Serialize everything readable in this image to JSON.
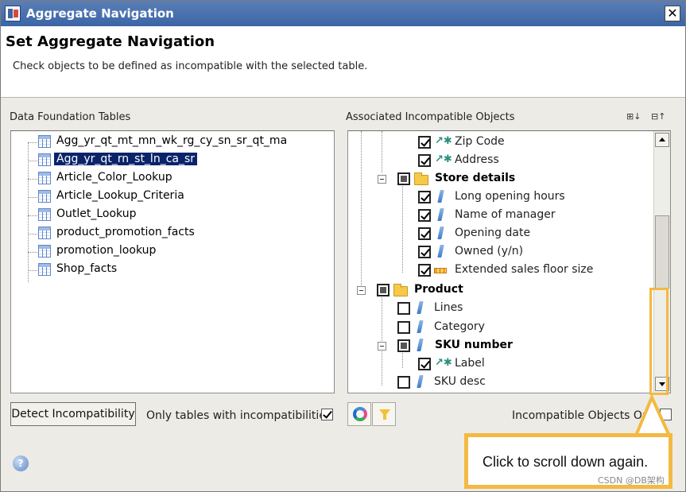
{
  "window": {
    "title": "Aggregate Navigation",
    "close_label": "✕"
  },
  "header": {
    "title": "Set Aggregate Navigation",
    "subtitle": "Check objects to be defined as incompatible with the selected table."
  },
  "left": {
    "label": "Data Foundation Tables",
    "tables": [
      "Agg_yr_qt_mt_mn_wk_rg_cy_sn_sr_qt_ma",
      "Agg_yr_qt_rn_st_ln_ca_sr",
      "Article_Color_Lookup",
      "Article_Lookup_Criteria",
      "Outlet_Lookup",
      "product_promotion_facts",
      "promotion_lookup",
      "Shop_facts"
    ],
    "selected_table": "Agg_yr_qt_rn_st_ln_ca_sr"
  },
  "right": {
    "label": "Associated Incompatible Objects",
    "items": [
      {
        "text": "Zip Code",
        "icon": "attribute-icon",
        "checked": true
      },
      {
        "text": "Address",
        "icon": "attribute-icon",
        "checked": true
      },
      {
        "text": "Store details",
        "icon": "folder-icon",
        "checked": "partial"
      },
      {
        "text": "Long opening hours",
        "icon": "dimension-icon",
        "checked": true
      },
      {
        "text": "Name of manager",
        "icon": "dimension-icon",
        "checked": true
      },
      {
        "text": "Opening date",
        "icon": "dimension-icon",
        "checked": true
      },
      {
        "text": "Owned (y/n)",
        "icon": "dimension-icon",
        "checked": true
      },
      {
        "text": "Extended sales floor size",
        "icon": "measure-icon",
        "checked": true
      },
      {
        "text": "Product",
        "icon": "folder-icon",
        "checked": "partial"
      },
      {
        "text": "Lines",
        "icon": "dimension-icon",
        "checked": false
      },
      {
        "text": "Category",
        "icon": "dimension-icon",
        "checked": false
      },
      {
        "text": "SKU number",
        "icon": "dimension-icon",
        "checked": "partial"
      },
      {
        "text": "Label",
        "icon": "attribute-icon",
        "checked": true
      },
      {
        "text": "SKU desc",
        "icon": "dimension-icon",
        "checked": false
      }
    ]
  },
  "footer": {
    "detect_button": "Detect Incompatibility",
    "only_tables_label": "Only tables with incompatibilities",
    "only_tables_checked": true,
    "incompatible_only_label": "Incompatible Objects Onl",
    "help_label": "?"
  },
  "callout": {
    "text": "Click to scroll down again."
  },
  "watermark": "CSDN @DB架构",
  "colors": {
    "titlebar": "#3c65a6",
    "selection": "#0a246a",
    "highlight": "#f4b942"
  }
}
